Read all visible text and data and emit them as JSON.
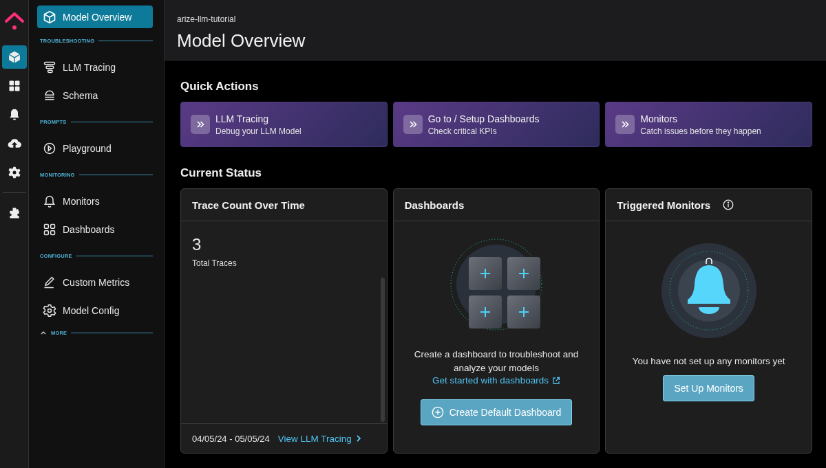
{
  "rail": {
    "items": [
      {
        "kind": "cube",
        "selected": true
      },
      {
        "kind": "grid",
        "selected": false
      },
      {
        "kind": "bell",
        "selected": false
      },
      {
        "kind": "upload",
        "selected": false
      },
      {
        "kind": "gear",
        "selected": false
      },
      {
        "kind": "puzzle",
        "selected": false
      }
    ]
  },
  "sidebar": {
    "top": {
      "label": "Model Overview",
      "kind": "cube",
      "selected": true
    },
    "sections": [
      {
        "heading": "TROUBLESHOOTING",
        "items": [
          {
            "label": "LLM Tracing",
            "kind": "tracing",
            "selected": false
          },
          {
            "label": "Schema",
            "kind": "schema",
            "selected": false
          }
        ]
      },
      {
        "heading": "PROMPTS",
        "items": [
          {
            "label": "Playground",
            "kind": "play",
            "selected": false
          }
        ]
      },
      {
        "heading": "MONITORING",
        "items": [
          {
            "label": "Monitors",
            "kind": "bell-outline",
            "selected": false
          },
          {
            "label": "Dashboards",
            "kind": "grid-outline",
            "selected": false
          }
        ]
      },
      {
        "heading": "CONFIGURE",
        "items": [
          {
            "label": "Custom Metrics",
            "kind": "pencil",
            "selected": false
          },
          {
            "label": "Model Config",
            "kind": "gear-outline",
            "selected": false
          }
        ]
      }
    ],
    "more": "MORE"
  },
  "header": {
    "breadcrumb": "arize-llm-tutorial",
    "title": "Model Overview"
  },
  "quick_actions": {
    "title": "Quick Actions",
    "items": [
      {
        "title": "LLM Tracing",
        "subtitle": "Debug your LLM Model"
      },
      {
        "title": "Go to / Setup Dashboards",
        "subtitle": "Check critical KPIs"
      },
      {
        "title": "Monitors",
        "subtitle": "Catch issues before they happen"
      }
    ]
  },
  "current_status": {
    "title": "Current Status",
    "cards": [
      {
        "kind": "trace",
        "title": "Trace Count Over Time",
        "count": "3",
        "count_label": "Total Traces",
        "date_range": "04/05/24 - 05/05/24",
        "link": "View LLM Tracing"
      },
      {
        "kind": "dashboards",
        "title": "Dashboards",
        "message": "Create a dashboard to troubleshoot and analyze your models",
        "link": "Get started with dashboards",
        "button": "Create Default Dashboard"
      },
      {
        "kind": "monitors",
        "title": "Triggered Monitors",
        "message": "You have not set up any monitors yet",
        "button": "Set Up Monitors"
      }
    ]
  }
}
